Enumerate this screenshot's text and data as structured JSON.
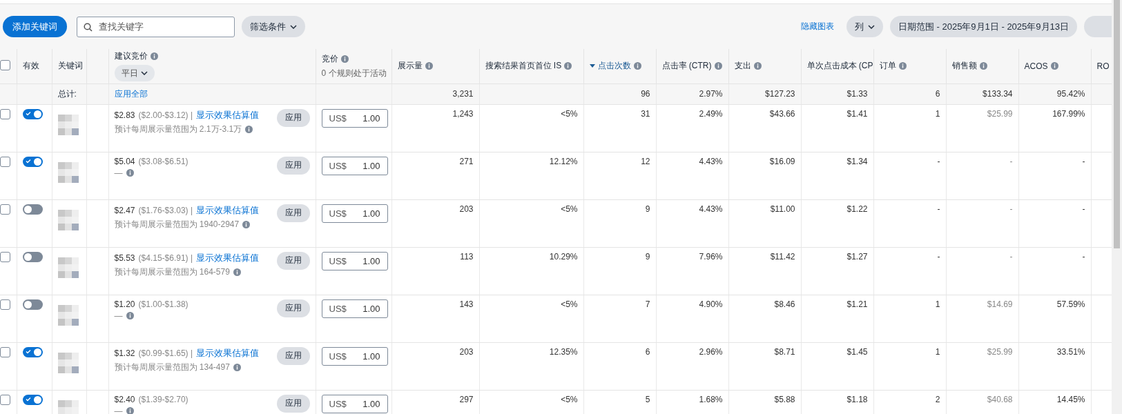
{
  "toolbar": {
    "add_button": "添加关键词",
    "search": {
      "placeholder": "查找关键字"
    },
    "filter_button": "筛选条件",
    "hide_chart_link": "隐藏图表",
    "columns_button": "列",
    "date_range_button": "日期范围 - 2025年9月1日 - 2025年9月13日"
  },
  "table": {
    "columns": [
      {
        "kind": "select",
        "checked": false
      },
      {
        "kind": "toggle",
        "label": "有效"
      },
      {
        "kind": "keyword",
        "label": "关键词"
      },
      {
        "kind": "blank"
      },
      {
        "kind": "suggested",
        "label": "建议竞价",
        "info": true,
        "dropdown": "平日"
      },
      {
        "kind": "bid",
        "label": "竞价",
        "info": true,
        "note": "0 个规则处于活动"
      },
      {
        "kind": "metric",
        "label": "展示量",
        "info": true,
        "sorted": false
      },
      {
        "kind": "metric",
        "label": "搜索结果首页首位 IS",
        "info": true,
        "sorted": false
      },
      {
        "kind": "metric",
        "label": "点击次数",
        "info": true,
        "sorted": true
      },
      {
        "kind": "metric",
        "label": "点击率 (CTR)",
        "info": true,
        "sorted": false
      },
      {
        "kind": "metric",
        "label": "支出",
        "info": true,
        "sorted": false
      },
      {
        "kind": "metric",
        "label": "单次点击成本 (CP",
        "sorted": false
      },
      {
        "kind": "metric",
        "label": "订单",
        "info": true,
        "sorted": false
      },
      {
        "kind": "metric",
        "label": "销售额",
        "info": true,
        "sorted": false
      },
      {
        "kind": "metric",
        "label": "ACOS",
        "info": true,
        "sorted": false
      },
      {
        "kind": "metric",
        "label": "RO",
        "sorted": false
      }
    ],
    "totals": {
      "label": "总计:",
      "apply_all": "应用全部",
      "values": [
        {
          "kind": "value",
          "text": "3,231"
        },
        {
          "kind": "blank"
        },
        {
          "kind": "value",
          "text": "96"
        },
        {
          "kind": "value",
          "text": "2.97%"
        },
        {
          "kind": "value",
          "text": "$127.23"
        },
        {
          "kind": "value",
          "text": "$1.33"
        },
        {
          "kind": "value",
          "text": "6"
        },
        {
          "kind": "value",
          "text": "$133.34"
        },
        {
          "kind": "value",
          "text": "95.42%"
        }
      ]
    },
    "rows": [
      {
        "checked": false,
        "enabled": true,
        "suggested": "$2.83",
        "range": "($2.00-$3.12) |",
        "estimate_link": "显示效果估算值",
        "estimate": "预计每周展示量范围为 2.1万-3.1万",
        "apply": "应用",
        "currency": "US$",
        "bid": "1.00",
        "values": [
          "1,243",
          "<5%",
          "31",
          "2.49%",
          "$43.66",
          "$1.41",
          "1",
          "$25.99",
          "167.99%"
        ]
      },
      {
        "checked": false,
        "enabled": true,
        "suggested": "$5.04",
        "range": "($3.08-$6.51)",
        "estimate": "—",
        "apply": "应用",
        "currency": "US$",
        "bid": "1.00",
        "values": [
          "271",
          "12.12%",
          "12",
          "4.43%",
          "$16.09",
          "$1.34",
          "-",
          "-",
          "-"
        ]
      },
      {
        "checked": false,
        "enabled": false,
        "suggested": "$2.47",
        "range": "($1.76-$3.03) |",
        "estimate_link": "显示效果估算值",
        "estimate": "预计每周展示量范围为 1940-2947",
        "apply": "应用",
        "currency": "US$",
        "bid": "1.00",
        "values": [
          "203",
          "<5%",
          "9",
          "4.43%",
          "$11.00",
          "$1.22",
          "-",
          "-",
          "-"
        ]
      },
      {
        "checked": false,
        "enabled": false,
        "suggested": "$5.53",
        "range": "($4.15-$6.91) |",
        "estimate_link": "显示效果估算值",
        "estimate": "预计每周展示量范围为 164-579",
        "apply": "应用",
        "currency": "US$",
        "bid": "1.00",
        "values": [
          "113",
          "10.29%",
          "9",
          "7.96%",
          "$11.42",
          "$1.27",
          "-",
          "-",
          "-"
        ]
      },
      {
        "checked": false,
        "enabled": false,
        "suggested": "$1.20",
        "range": "($1.00-$1.38)",
        "estimate": "—",
        "apply": "应用",
        "currency": "US$",
        "bid": "1.00",
        "values": [
          "143",
          "<5%",
          "7",
          "4.90%",
          "$8.46",
          "$1.21",
          "1",
          "$14.69",
          "57.59%"
        ]
      },
      {
        "checked": false,
        "enabled": true,
        "suggested": "$1.32",
        "range": "($0.99-$1.65) |",
        "estimate_link": "显示效果估算值",
        "estimate": "预计每周展示量范围为 134-497",
        "apply": "应用",
        "currency": "US$",
        "bid": "1.00",
        "values": [
          "203",
          "12.35%",
          "6",
          "2.96%",
          "$8.71",
          "$1.45",
          "1",
          "$25.99",
          "33.51%"
        ]
      },
      {
        "checked": false,
        "enabled": true,
        "suggested": "$2.40",
        "range": "($1.39-$2.70)",
        "estimate": "—",
        "apply": "应用",
        "currency": "US$",
        "bid": "1.00",
        "values": [
          "297",
          "<5%",
          "5",
          "1.68%",
          "$5.88",
          "$1.18",
          "2",
          "$40.68",
          "14.45%"
        ]
      }
    ]
  }
}
